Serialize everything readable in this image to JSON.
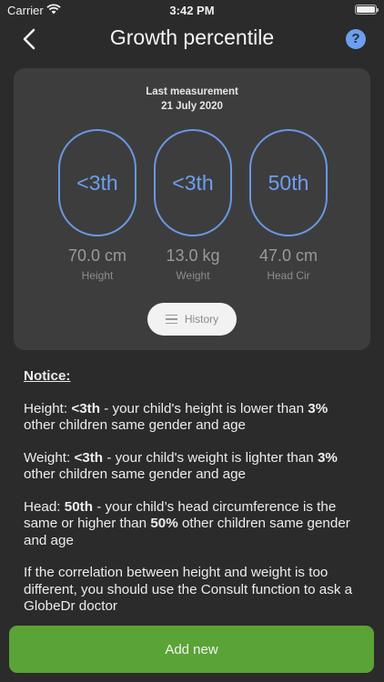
{
  "status_bar": {
    "carrier": "Carrier",
    "time": "3:42 PM"
  },
  "nav": {
    "title": "Growth percentile"
  },
  "card": {
    "heading_line1": "Last measurement",
    "heading_line2": "21 July  2020",
    "metrics": [
      {
        "percentile": "<3th",
        "value": "70.0 cm",
        "label": "Height"
      },
      {
        "percentile": "<3th",
        "value": "13.0 kg",
        "label": "Weight"
      },
      {
        "percentile": "50th",
        "value": "47.0 cm",
        "label": "Head Cir"
      }
    ],
    "history_label": "History"
  },
  "notice": {
    "title": "Notice:",
    "height": {
      "prefix": "Height: ",
      "pct": "<3th",
      "text": " - your child's height is lower than ",
      "pct2": "3%",
      "suffix": " other children same gender and age"
    },
    "weight": {
      "prefix": "Weight: ",
      "pct": "<3th",
      "text": " - your child's weight is lighter than ",
      "pct2": "3%",
      "suffix": " other children same gender and age"
    },
    "head": {
      "prefix": "Head: ",
      "pct": "50th",
      "text": " - your child’s head circumference is the same or higher than ",
      "pct2": "50%",
      "suffix": " other children same gender and age"
    },
    "consult": "If the correlation between height and weight is too different, you should use the Consult function to ask a GlobeDr doctor"
  },
  "footer": {
    "add_label": "Add new"
  },
  "colors": {
    "accent_blue": "#6d9ff0",
    "add_green": "#5aa336",
    "background": "#2b2b2b",
    "card": "#3d3d3e"
  }
}
